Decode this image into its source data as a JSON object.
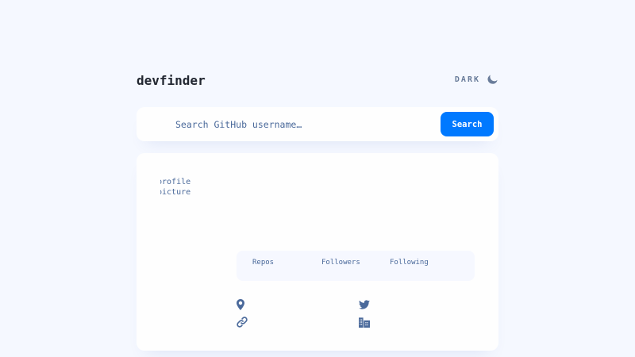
{
  "header": {
    "logo": "devfinder",
    "theme_label": "DARK",
    "theme_icon": "moon-icon"
  },
  "search": {
    "placeholder": "Search GitHub username…",
    "value": "",
    "button_label": "Search",
    "accent_color": "#0079ff"
  },
  "profile": {
    "avatar_alt": "profile picture",
    "stats": {
      "repos_label": "Repos",
      "followers_label": "Followers",
      "following_label": "Following"
    },
    "links": {
      "location": "",
      "twitter": "",
      "blog": "",
      "company": ""
    },
    "icons": {
      "location": "location-pin-icon",
      "twitter": "twitter-icon",
      "blog": "link-icon",
      "company": "building-icon"
    }
  },
  "colors": {
    "background": "#f5f8ff",
    "card": "#fefefe",
    "text": "#4b6a9b",
    "heading": "#222731"
  }
}
